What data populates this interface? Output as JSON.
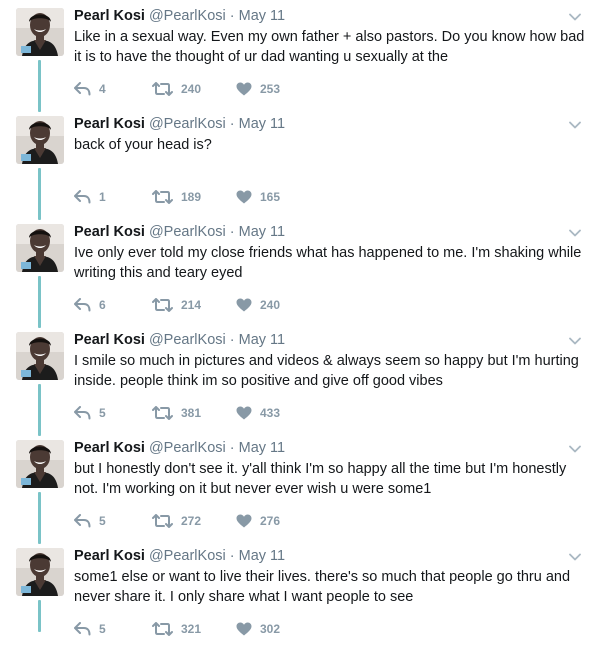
{
  "author": {
    "name": "Pearl Kosi",
    "handle": "@PearlKosi"
  },
  "colors": {
    "thread_line": "#7ac3c7",
    "name": "#14171a",
    "meta": "#657786",
    "actions": "#8899a6"
  },
  "icons": {
    "reply": "reply-arrow-icon",
    "retweet": "retweet-icon",
    "like": "heart-icon",
    "menu": "chevron-down-icon"
  },
  "tweets": [
    {
      "date": "May 11",
      "text": "Like in a sexual way. Even my own father + also pastors. Do you know how bad it is to have the thought of ur dad wanting u sexually at the",
      "replies": "4",
      "retweets": "240",
      "likes": "253"
    },
    {
      "date": "May 11",
      "text": "back of your head is?",
      "replies": "1",
      "retweets": "189",
      "likes": "165"
    },
    {
      "date": "May 11",
      "text": "Ive only ever told my close friends what has happened to me. I'm shaking while writing this and teary eyed",
      "replies": "6",
      "retweets": "214",
      "likes": "240"
    },
    {
      "date": "May 11",
      "text": "I smile so much in pictures and videos & always seem so happy but I'm hurting inside. people think im so positive and give off good vibes",
      "replies": "5",
      "retweets": "381",
      "likes": "433"
    },
    {
      "date": "May 11",
      "text": "but I honestly don't see it. y'all think I'm so happy all the time but I'm honestly not. I'm working on it but never ever wish u were some1",
      "replies": "5",
      "retweets": "272",
      "likes": "276"
    },
    {
      "date": "May 11",
      "text": "some1 else or want to live their lives. there's so much that people go thru and never share it. I only share what I want people to see",
      "replies": "5",
      "retweets": "321",
      "likes": "302"
    }
  ]
}
